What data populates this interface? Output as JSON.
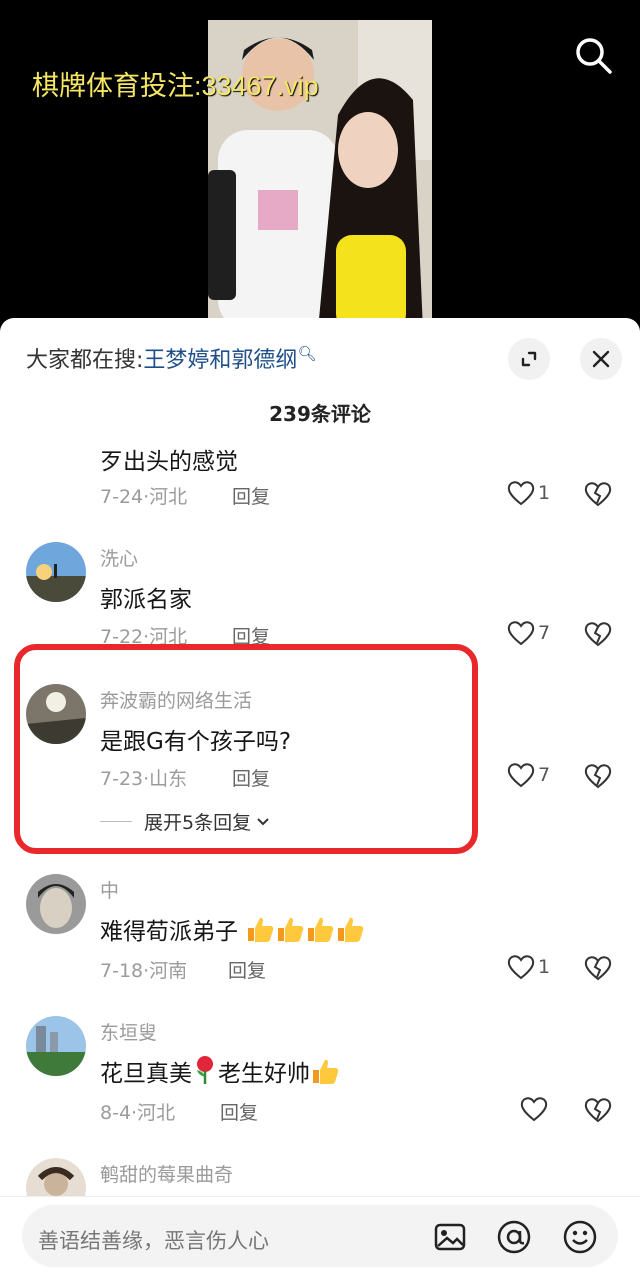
{
  "watermark": "棋牌体育投注:33467.vip",
  "hot_search": {
    "prefix": "大家都在搜:",
    "keyword": "王梦婷和郭德纲"
  },
  "comment_count": "239条评论",
  "comments": [
    {
      "user": "",
      "text": "歹出头的感觉",
      "date": "7-24",
      "region": "河北",
      "reply": "回复",
      "likes": "1"
    },
    {
      "user": "洗心",
      "text": "郭派名家",
      "date": "7-22",
      "region": "河北",
      "reply": "回复",
      "likes": "7"
    },
    {
      "user": "奔波霸的网络生活",
      "text": "是跟G有个孩子吗?",
      "date": "7-23",
      "region": "山东",
      "reply": "回复",
      "likes": "7",
      "expand": "展开5条回复"
    },
    {
      "user": "中",
      "text": "难得荀派弟子",
      "date": "7-18",
      "region": "河南",
      "reply": "回复",
      "likes": "1"
    },
    {
      "user": "东垣叟",
      "text_a": "花旦真美",
      "text_b": "老生好帅",
      "date": "8-4",
      "region": "河北",
      "reply": "回复",
      "likes": ""
    },
    {
      "user": "鹌甜的莓果曲奇"
    }
  ],
  "input": {
    "placeholder": "善语结善缘，恶言伤人心"
  },
  "colors": {
    "highlight": "#e8282b",
    "hot_keyword": "#1f4f8a",
    "watermark": "#f5e663"
  },
  "icons": [
    "search-icon",
    "expand-icon",
    "close-icon",
    "heart-icon",
    "broken-heart-icon",
    "image-icon",
    "at-icon",
    "smiley-icon",
    "thumbs-up-emoji",
    "rose-emoji"
  ]
}
